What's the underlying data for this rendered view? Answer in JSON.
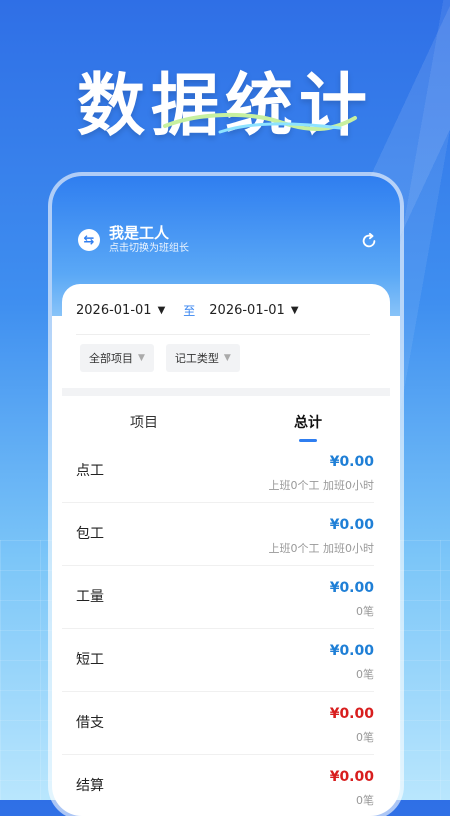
{
  "headline": "数据统计",
  "user": {
    "name": "我是工人",
    "subtitle": "点击切换为班组长"
  },
  "filters": {
    "start_date": "2026-01-01",
    "separator": "至",
    "end_date": "2026-01-01",
    "project": "全部项目",
    "record_type": "记工类型"
  },
  "tabs": [
    "项目",
    "总计"
  ],
  "active_tab": "总计",
  "colors": {
    "income": "#1f7fd6",
    "expense": "#d81e1e",
    "accent": "#2f7ef0"
  },
  "items": [
    {
      "name": "点工",
      "amount": "¥0.00",
      "detail": "上班0个工 加班0小时",
      "color": "#1f7fd6"
    },
    {
      "name": "包工",
      "amount": "¥0.00",
      "detail": "上班0个工 加班0小时",
      "color": "#1f7fd6"
    },
    {
      "name": "工量",
      "amount": "¥0.00",
      "detail": "0笔",
      "color": "#1f7fd6"
    },
    {
      "name": "短工",
      "amount": "¥0.00",
      "detail": "0笔",
      "color": "#1f7fd6"
    },
    {
      "name": "借支",
      "amount": "¥0.00",
      "detail": "0笔",
      "color": "#d81e1e"
    },
    {
      "name": "结算",
      "amount": "¥0.00",
      "detail": "0笔",
      "color": "#d81e1e"
    }
  ]
}
